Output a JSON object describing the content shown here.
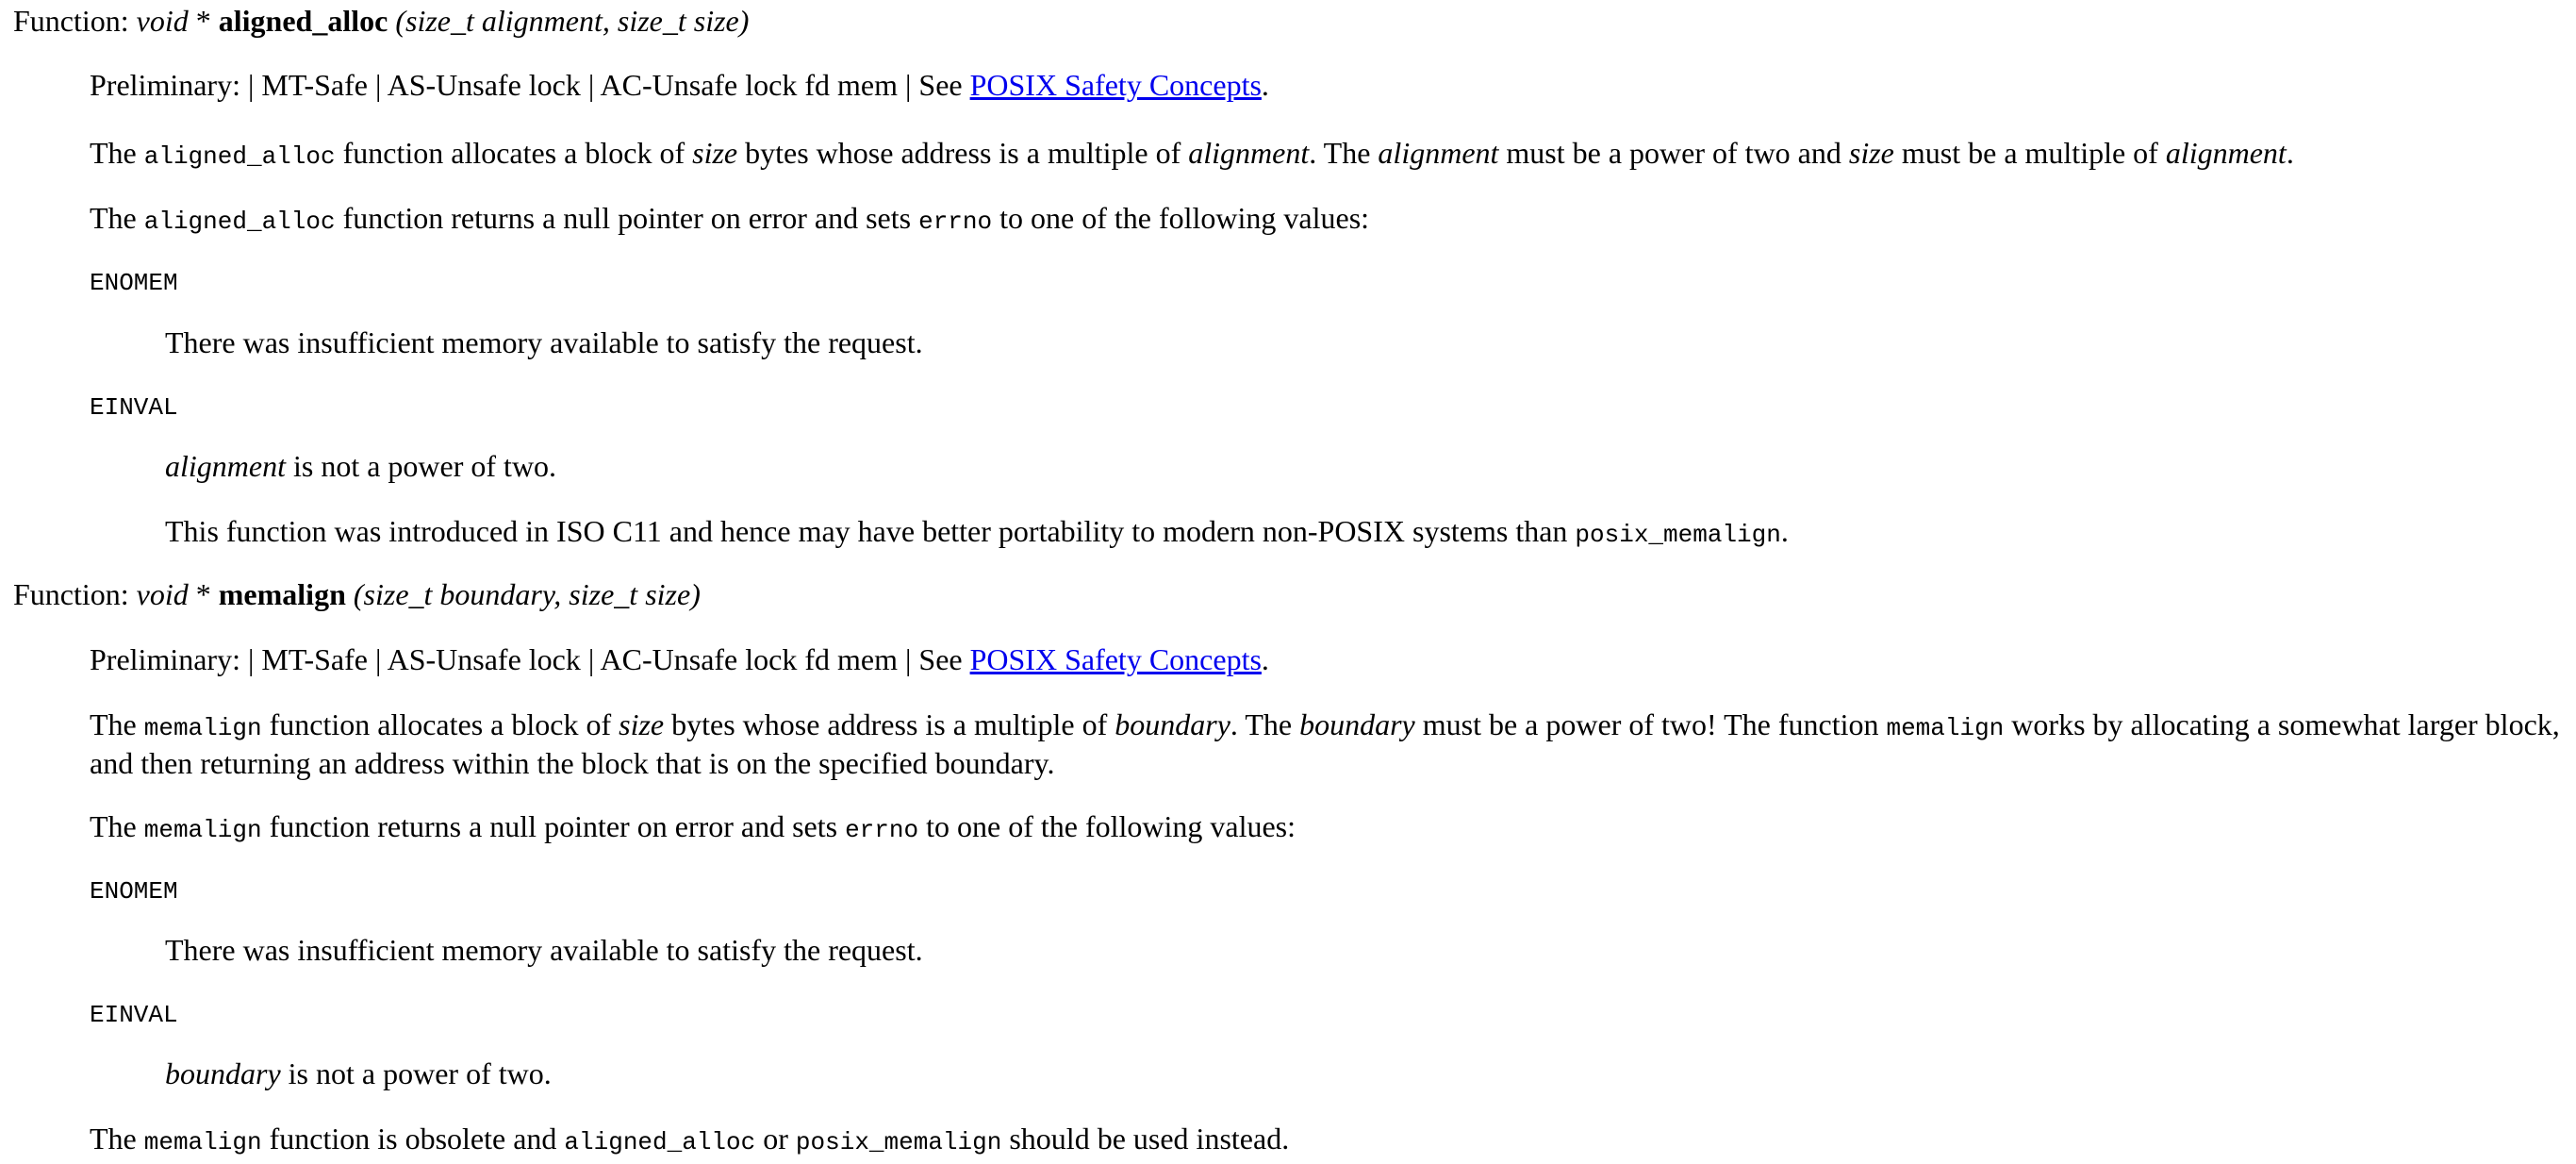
{
  "colors": {
    "link": "#0000ee",
    "text": "#000000",
    "background": "#ffffff"
  },
  "entries": [
    {
      "header": {
        "prefix": "Function: ",
        "ret": "void",
        "star": " * ",
        "name": "aligned_alloc",
        "args": " (size_t alignment, size_t size)"
      },
      "preliminary": {
        "text": "Preliminary: | MT-Safe | AS-Unsafe lock | AC-Unsafe lock fd mem | See ",
        "link": "POSIX Safety Concepts",
        "end": "."
      },
      "desc": {
        "t1": "The ",
        "c1": "aligned_alloc",
        "t2": " function allocates a block of ",
        "i1": "size",
        "t3": " bytes whose address is a multiple of ",
        "i2": "alignment",
        "t4": ". The ",
        "i3": "alignment",
        "t5": " must be a power of two and ",
        "i4": "size",
        "t6": " must be a multiple of ",
        "i5": "alignment",
        "t7": "."
      },
      "returns": {
        "t1": "The ",
        "c1": "aligned_alloc",
        "t2": " function returns a null pointer on error and sets ",
        "c2": "errno",
        "t3": " to one of the following values:"
      },
      "errors": [
        {
          "code": "ENOMEM",
          "desc": "There was insufficient memory available to satisfy the request."
        },
        {
          "code": "EINVAL",
          "desc_italic": "alignment",
          "desc_rest": " is not a power of two."
        }
      ],
      "note": {
        "t1": "This function was introduced in ISO C11 and hence may have better portability to modern non-POSIX systems than ",
        "c1": "posix_memalign",
        "t2": "."
      }
    },
    {
      "header": {
        "prefix": "Function: ",
        "ret": "void",
        "star": " * ",
        "name": "memalign",
        "args": " (size_t boundary, size_t size)"
      },
      "preliminary": {
        "text": "Preliminary: | MT-Safe | AS-Unsafe lock | AC-Unsafe lock fd mem | See ",
        "link": "POSIX Safety Concepts",
        "end": "."
      },
      "desc": {
        "t1": "The ",
        "c1": "memalign",
        "t2": " function allocates a block of ",
        "i1": "size",
        "t3": " bytes whose address is a multiple of ",
        "i2": "boundary",
        "t4": ". The ",
        "i3": "boundary",
        "t5": " must be a power of two! The function ",
        "c2": "memalign",
        "t6": " works by allocating a somewhat larger block, and then returning an address within the block that is on the specified boundary."
      },
      "returns": {
        "t1": "The ",
        "c1": "memalign",
        "t2": " function returns a null pointer on error and sets ",
        "c2": "errno",
        "t3": " to one of the following values:"
      },
      "errors": [
        {
          "code": "ENOMEM",
          "desc": "There was insufficient memory available to satisfy the request."
        },
        {
          "code": "EINVAL",
          "desc_italic": "boundary",
          "desc_rest": " is not a power of two."
        }
      ],
      "note": {
        "t1": "The ",
        "c1": "memalign",
        "t2": " function is obsolete and ",
        "c2": "aligned_alloc",
        "t3": " or ",
        "c3": "posix_memalign",
        "t4": " should be used instead."
      }
    }
  ]
}
